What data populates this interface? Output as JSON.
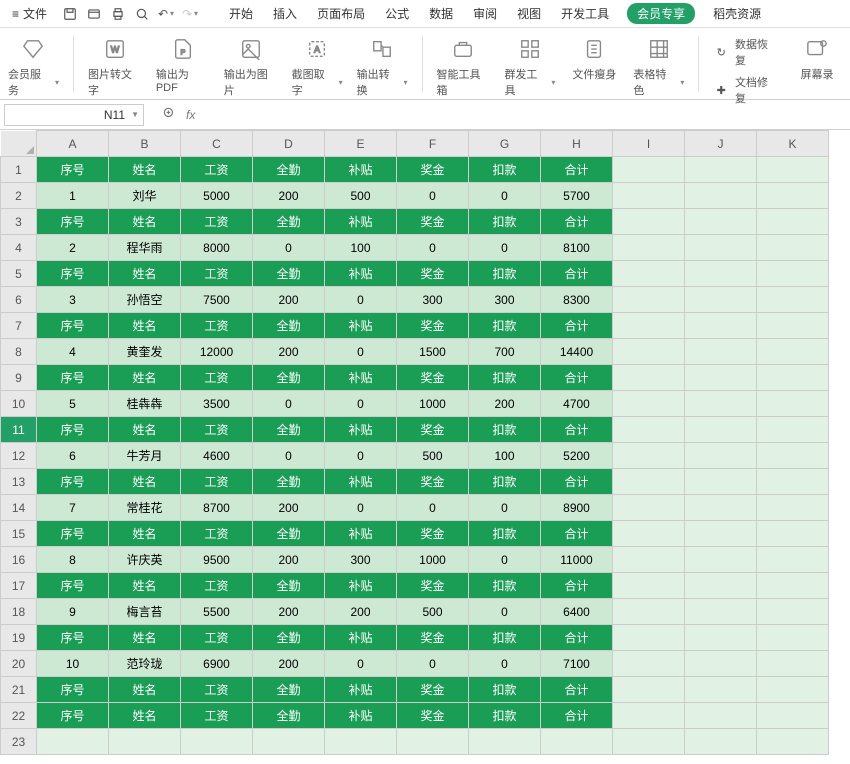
{
  "menu": {
    "file": "文件"
  },
  "tabs": [
    "开始",
    "插入",
    "页面布局",
    "公式",
    "数据",
    "审阅",
    "视图",
    "开发工具",
    "会员专享",
    "稻壳资源"
  ],
  "ribbon": {
    "g0": "会员服务",
    "g1": "图片转文字",
    "g2": "输出为PDF",
    "g3": "输出为图片",
    "g4": "截图取字",
    "g5": "输出转换",
    "g6": "智能工具箱",
    "g7": "群发工具",
    "g8": "文件瘦身",
    "g9": "表格特色",
    "r1": "数据恢复",
    "r2": "文档修复",
    "r3": "屏幕录"
  },
  "namebox": "N11",
  "cols": [
    "A",
    "B",
    "C",
    "D",
    "E",
    "F",
    "G",
    "H",
    "I",
    "J",
    "K"
  ],
  "header": [
    "序号",
    "姓名",
    "工资",
    "全勤",
    "补贴",
    "奖金",
    "扣款",
    "合计"
  ],
  "rows": [
    {
      "t": "h"
    },
    {
      "t": "d",
      "v": [
        "1",
        "刘华",
        "5000",
        "200",
        "500",
        "0",
        "0",
        "5700"
      ]
    },
    {
      "t": "h"
    },
    {
      "t": "d",
      "v": [
        "2",
        "程华雨",
        "8000",
        "0",
        "100",
        "0",
        "0",
        "8100"
      ]
    },
    {
      "t": "h"
    },
    {
      "t": "d",
      "v": [
        "3",
        "孙悟空",
        "7500",
        "200",
        "0",
        "300",
        "300",
        "8300"
      ]
    },
    {
      "t": "h"
    },
    {
      "t": "d",
      "v": [
        "4",
        "黄奎发",
        "12000",
        "200",
        "0",
        "1500",
        "700",
        "14400"
      ]
    },
    {
      "t": "h"
    },
    {
      "t": "d",
      "v": [
        "5",
        "桂犇犇",
        "3500",
        "0",
        "0",
        "1000",
        "200",
        "4700"
      ]
    },
    {
      "t": "h"
    },
    {
      "t": "d",
      "v": [
        "6",
        "牛芳月",
        "4600",
        "0",
        "0",
        "500",
        "100",
        "5200"
      ]
    },
    {
      "t": "h"
    },
    {
      "t": "d",
      "v": [
        "7",
        "常桂花",
        "8700",
        "200",
        "0",
        "0",
        "0",
        "8900"
      ]
    },
    {
      "t": "h"
    },
    {
      "t": "d",
      "v": [
        "8",
        "许庆英",
        "9500",
        "200",
        "300",
        "1000",
        "0",
        "11000"
      ]
    },
    {
      "t": "h"
    },
    {
      "t": "d",
      "v": [
        "9",
        "梅言苔",
        "5500",
        "200",
        "200",
        "500",
        "0",
        "6400"
      ]
    },
    {
      "t": "h"
    },
    {
      "t": "d",
      "v": [
        "10",
        "范玲珑",
        "6900",
        "200",
        "0",
        "0",
        "0",
        "7100"
      ]
    },
    {
      "t": "h"
    },
    {
      "t": "h"
    },
    {
      "t": "e"
    }
  ],
  "activeRow": 11
}
